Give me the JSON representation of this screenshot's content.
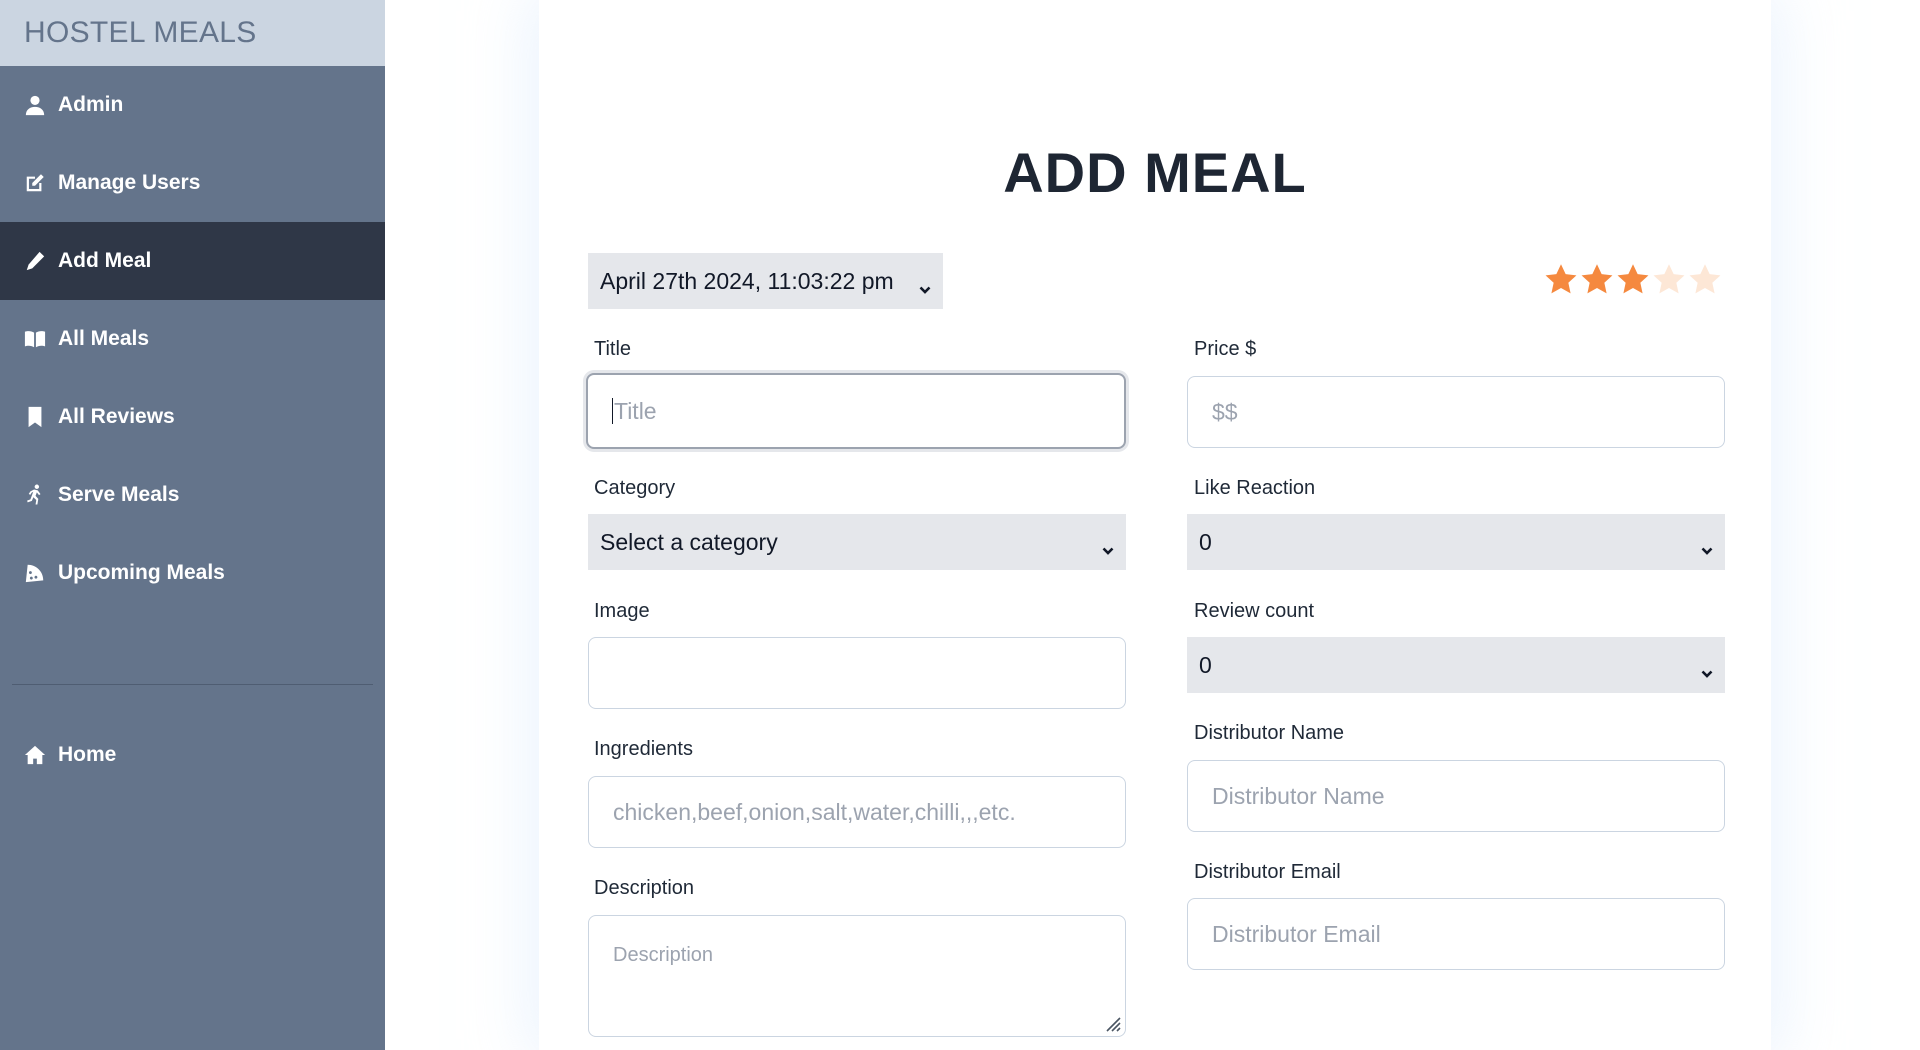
{
  "brand": "HOSTEL MEALS",
  "sidebar": {
    "items": [
      {
        "label": "Admin",
        "icon": "user-icon"
      },
      {
        "label": "Manage Users",
        "icon": "edit-icon"
      },
      {
        "label": "Add Meal",
        "icon": "pencil-icon",
        "active": true
      },
      {
        "label": "All Meals",
        "icon": "book-open-icon"
      },
      {
        "label": "All Reviews",
        "icon": "bookmark-icon"
      },
      {
        "label": "Serve Meals",
        "icon": "running-person-icon"
      },
      {
        "label": "Upcoming Meals",
        "icon": "pizza-slice-icon"
      }
    ],
    "home": {
      "label": "Home",
      "icon": "home-icon"
    }
  },
  "main": {
    "title": "ADD MEAL",
    "date_value": "April 27th 2024, 11:03:22 pm",
    "rating": {
      "value": 3,
      "max": 5,
      "filled_color": "#f5893f",
      "empty_color": "#fde7d6"
    },
    "form": {
      "title_label": "Title",
      "title_placeholder": "Title",
      "price_label": "Price $",
      "price_placeholder": "$$",
      "category_label": "Category",
      "category_value": "Select a category",
      "like_label": "Like Reaction",
      "like_value": "0",
      "image_label": "Image",
      "review_label": "Review count",
      "review_value": "0",
      "ingredients_label": "Ingredients",
      "ingredients_placeholder": "chicken,beef,onion,salt,water,chilli,,,etc.",
      "distributor_name_label": "Distributor Name",
      "distributor_name_placeholder": "Distributor Name",
      "description_label": "Description",
      "description_placeholder": "Description",
      "distributor_email_label": "Distributor Email",
      "distributor_email_placeholder": "Distributor Email"
    }
  },
  "colors": {
    "sidebar_bg": "#64748b",
    "sidebar_active": "#2f3747",
    "brand_bg": "#cbd5e1",
    "select_bg": "#e5e7eb"
  }
}
